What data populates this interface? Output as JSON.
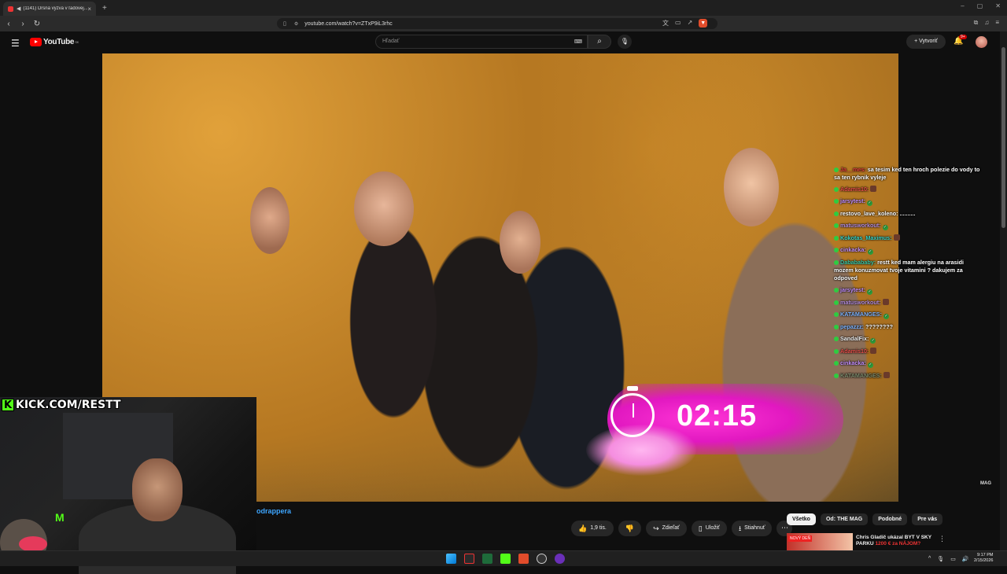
{
  "browser": {
    "tab_title": "(1141) Drsná výzva v ľadovej...",
    "tab_close": "×",
    "new_tab": "+",
    "url": "youtube.com/watch?v=ZTxP9iL3rhc"
  },
  "youtube": {
    "logo": "YouTube",
    "region": "SK",
    "search_placeholder": "Hľadať",
    "create_label": "Vytvoriť",
    "notif_count": "9+"
  },
  "video": {
    "timer": "02:15",
    "watermark": "MAG",
    "title_fragment": "odrappera"
  },
  "chat": {
    "messages": [
      {
        "user": "Ja__mes:",
        "text": " sa tesim ked ten hroch polezie do vody to sa ten rybnik vyleje",
        "color": "#e0403a"
      },
      {
        "user": "Adamis10:",
        "text": "",
        "color": "#e8504a"
      },
      {
        "user": "jarsytest:",
        "text": "",
        "color": "#c490ff"
      },
      {
        "user": "restovo_lave_koleno:",
        "text": " ..........",
        "color": "#ffffff"
      },
      {
        "user": "matusworkout:",
        "text": "",
        "color": "#b68fe0"
      },
      {
        "user": "Kokotas_Maximus:",
        "text": "",
        "color": "#33d3c9"
      },
      {
        "user": "cinkacka:",
        "text": "",
        "color": "#c490ff"
      },
      {
        "user": "Dababababy:",
        "text": " restt ked mam alergiu na arasidi mozem konuzmovat tvoje vitamini ? dakujem za odpoved",
        "color": "#3ac6a6"
      },
      {
        "user": "jarsytest:",
        "text": "",
        "color": "#c490ff"
      },
      {
        "user": "matusworkout:",
        "text": "",
        "color": "#b68fe0"
      },
      {
        "user": "KATAMANGES:",
        "text": "",
        "color": "#7fb5ff"
      },
      {
        "user": "pepazzz:",
        "text": " ????????",
        "color": "#7fb5ff"
      },
      {
        "user": "SandalFix:",
        "text": "",
        "color": "#f1f1f1"
      },
      {
        "user": "Adamis10:",
        "text": "",
        "color": "#e8504a"
      },
      {
        "user": "cinkacka:",
        "text": "",
        "color": "#c490ff"
      },
      {
        "user": "KATAMANGES:",
        "text": "",
        "color": "#7c8a6c"
      }
    ]
  },
  "stream": {
    "kick_badge": "K",
    "kick_url": "KICK.COM/RESTT"
  },
  "actions": {
    "like_count": "1,9 tis.",
    "share": "Zdieľať",
    "save": "Uložiť",
    "download": "Stiahnuť",
    "more": "⋯"
  },
  "filters": [
    "Všetko",
    "Od: THE MAG",
    "Podobné",
    "Pre vás"
  ],
  "recommendation": {
    "badge": "NOVÝ DEŇ",
    "title_part1": "Chris Gladič ukázal BYT V SKY PARKU",
    "title_part2": " 1200 € za NÁJOM?"
  },
  "taskbar": {
    "time": "9:17 PM",
    "date": "2/15/2026"
  },
  "colors": {
    "youtube_red": "#ff0000",
    "timer_pink": "#e118c0",
    "kick_green": "#53fc18",
    "link_blue": "#3ea6ff"
  }
}
